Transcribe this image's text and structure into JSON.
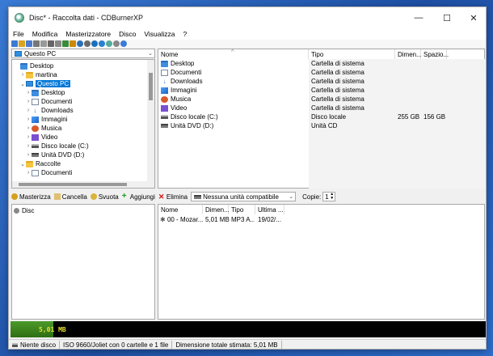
{
  "window": {
    "title": "Disc* - Raccolta dati - CDBurnerXP",
    "controls": [
      "—",
      "☐",
      "✕"
    ]
  },
  "menubar": [
    "File",
    "Modifica",
    "Masterizzatore",
    "Disco",
    "Visualizza",
    "?"
  ],
  "toolbar_icons": [
    "new-icon",
    "open-icon",
    "save-icon",
    "print-icon",
    "cut-icon",
    "copy-icon",
    "paste-icon",
    "burn-icon",
    "erase-icon",
    "disc-icon",
    "settings-icon",
    "help-icon",
    "info-icon",
    "refresh-icon",
    "properties-icon",
    "about-icon"
  ],
  "source_combo": "Questo PC",
  "tree": [
    {
      "label": "Desktop",
      "icon": "folder-blue",
      "indent": 0,
      "expander": ""
    },
    {
      "label": "martina",
      "icon": "folder",
      "indent": 1,
      "expander": "›"
    },
    {
      "label": "Questo PC",
      "icon": "pc",
      "indent": 1,
      "expander": "⌄",
      "selected": true
    },
    {
      "label": "Desktop",
      "icon": "folder-blue",
      "indent": 2,
      "expander": "›"
    },
    {
      "label": "Documenti",
      "icon": "doc",
      "indent": 2,
      "expander": "›"
    },
    {
      "label": "Downloads",
      "icon": "dl",
      "indent": 2,
      "expander": "›"
    },
    {
      "label": "Immagini",
      "icon": "img",
      "indent": 2,
      "expander": "›"
    },
    {
      "label": "Musica",
      "icon": "music",
      "indent": 2,
      "expander": "›"
    },
    {
      "label": "Video",
      "icon": "video",
      "indent": 2,
      "expander": "›"
    },
    {
      "label": "Disco locale (C:)",
      "icon": "disk",
      "indent": 2,
      "expander": "›"
    },
    {
      "label": "Unità DVD (D:)",
      "icon": "dvd",
      "indent": 2,
      "expander": "›"
    },
    {
      "label": "Raccolte",
      "icon": "folder",
      "indent": 1,
      "expander": "⌄"
    },
    {
      "label": "Documenti",
      "icon": "doc",
      "indent": 2,
      "expander": "›"
    }
  ],
  "files_table": {
    "headers": [
      "Nome",
      "Tipo",
      "Dimen...",
      "Spazio..."
    ],
    "rows": [
      {
        "name": "Desktop",
        "type": "Cartella di sistema",
        "size": "",
        "free": "",
        "icon": "folder-blue"
      },
      {
        "name": "Documenti",
        "type": "Cartella di sistema",
        "size": "",
        "free": "",
        "icon": "doc"
      },
      {
        "name": "Downloads",
        "type": "Cartella di sistema",
        "size": "",
        "free": "",
        "icon": "dl"
      },
      {
        "name": "Immagini",
        "type": "Cartella di sistema",
        "size": "",
        "free": "",
        "icon": "img"
      },
      {
        "name": "Musica",
        "type": "Cartella di sistema",
        "size": "",
        "free": "",
        "icon": "music"
      },
      {
        "name": "Video",
        "type": "Cartella di sistema",
        "size": "",
        "free": "",
        "icon": "video"
      },
      {
        "name": "Disco locale (C:)",
        "type": "Disco locale",
        "size": "255 GB",
        "free": "156 GB",
        "icon": "disk"
      },
      {
        "name": "Unità DVD (D:)",
        "type": "Unità CD",
        "size": "",
        "free": "",
        "icon": "dvd"
      }
    ]
  },
  "toolbar2": {
    "burn": "Masterizza",
    "delete": "Cancella",
    "empty": "Svuota",
    "add": "Aggiungi",
    "remove": "Elimina",
    "drive": "Nessuna unità compatibile",
    "copies_label": "Copie:",
    "copies_value": "1"
  },
  "disc_tree": {
    "label": "Disc"
  },
  "disc_table": {
    "headers": [
      "Nome",
      "Dimen...",
      "Tipo",
      "Ultima ..."
    ],
    "rows": [
      {
        "name": "00 - Mozar...",
        "size": "5,01 MB",
        "type": "MP3 A...",
        "date": "19/02/..."
      }
    ]
  },
  "progress": {
    "label": "5,01 MB",
    "fraction": 0.09
  },
  "statusbar": [
    "Niente disco",
    "ISO 9660/Joliet con 0 cartelle e 1 file",
    "Dimensione totale stimata: 5,01 MB"
  ]
}
